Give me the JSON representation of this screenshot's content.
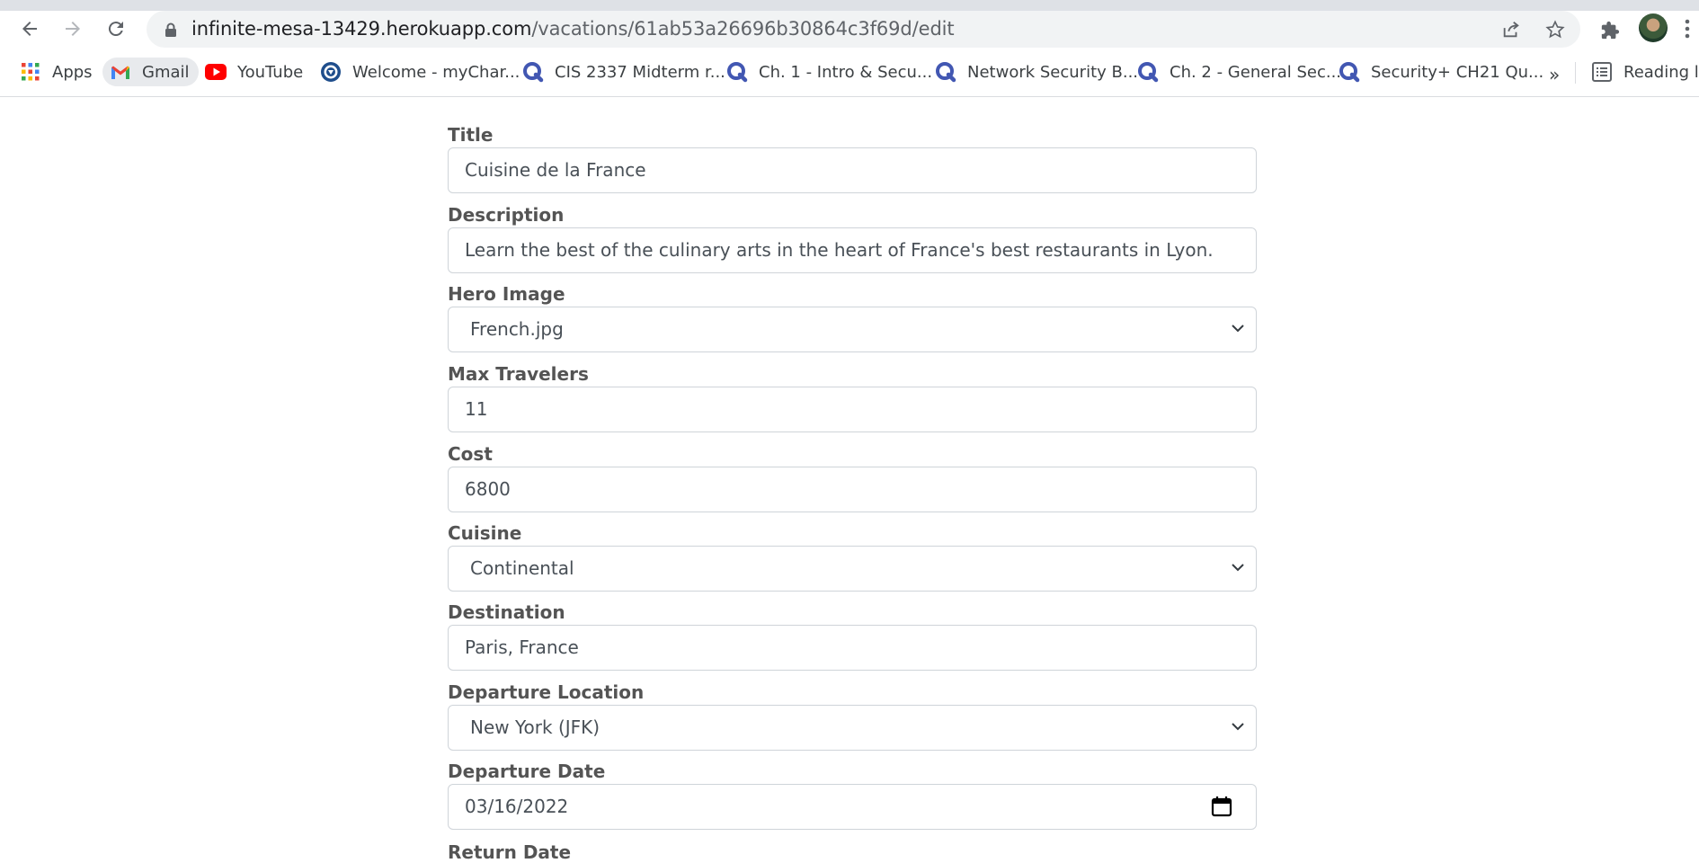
{
  "browser": {
    "url_host": "infinite-mesa-13429.herokuapp.com",
    "url_path": "/vacations/61ab53a26696b30864c3f69d/edit",
    "bookmarks": [
      {
        "label": "Apps",
        "icon": "apps-grid-icon"
      },
      {
        "label": "Gmail",
        "icon": "gmail-icon"
      },
      {
        "label": "YouTube",
        "icon": "youtube-icon"
      },
      {
        "label": "Welcome - myChar...",
        "icon": "site-seal-icon"
      },
      {
        "label": "CIS 2337 Midterm r...",
        "icon": "quizlet-icon"
      },
      {
        "label": "Ch. 1 - Intro & Secu...",
        "icon": "quizlet-icon"
      },
      {
        "label": "Network Security B...",
        "icon": "quizlet-icon"
      },
      {
        "label": "Ch. 2 - General Sec...",
        "icon": "quizlet-icon"
      },
      {
        "label": "Security+ CH21 Qu...",
        "icon": "quizlet-icon"
      }
    ],
    "overflow": "»",
    "reading_list": "Reading list"
  },
  "form": {
    "fields": [
      {
        "label": "Title",
        "value": "Cuisine de la France",
        "kind": "text"
      },
      {
        "label": "Description",
        "value": "Learn the best of the culinary arts in the heart of France's best restaurants in Lyon.",
        "kind": "text"
      },
      {
        "label": "Hero Image",
        "value": "French.jpg",
        "kind": "select"
      },
      {
        "label": "Max Travelers",
        "value": "11",
        "kind": "text"
      },
      {
        "label": "Cost",
        "value": "6800",
        "kind": "text"
      },
      {
        "label": "Cuisine",
        "value": "Continental",
        "kind": "select"
      },
      {
        "label": "Destination",
        "value": "Paris, France",
        "kind": "text"
      },
      {
        "label": "Departure Location",
        "value": "New York (JFK)",
        "kind": "select"
      },
      {
        "label": "Departure Date",
        "value": "03/16/2022",
        "kind": "date"
      },
      {
        "label": "Return Date",
        "value": "",
        "kind": "date"
      }
    ]
  },
  "colors": {
    "quizlet": "#4257b2",
    "youtube": "#ff0000",
    "label_text": "#545454",
    "input_border": "#cfd4d9"
  }
}
